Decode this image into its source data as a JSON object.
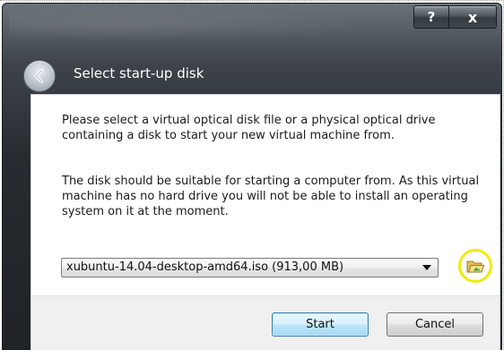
{
  "window": {
    "title": "Select start-up disk",
    "help_glyph": "?",
    "close_glyph": "x"
  },
  "body": {
    "paragraph1": "Please select a virtual optical disk file or a physical optical drive containing a disk to start your new virtual machine from.",
    "paragraph2": "The disk should be suitable for starting a computer from. As this virtual machine has no hard drive you will not be able to install an operating system on it at the moment."
  },
  "disk_selector": {
    "selected_value": "xubuntu-14.04-desktop-amd64.iso (913,00 MB)"
  },
  "buttons": {
    "start_label": "Start",
    "cancel_label": "Cancel"
  },
  "icons": {
    "back": "back-arrow-icon",
    "dropdown": "chevron-down-icon",
    "choose_disk": "folder-open-icon"
  },
  "colors": {
    "highlight_ring": "#f2ea00",
    "default_button_border": "#3c7fb1"
  }
}
